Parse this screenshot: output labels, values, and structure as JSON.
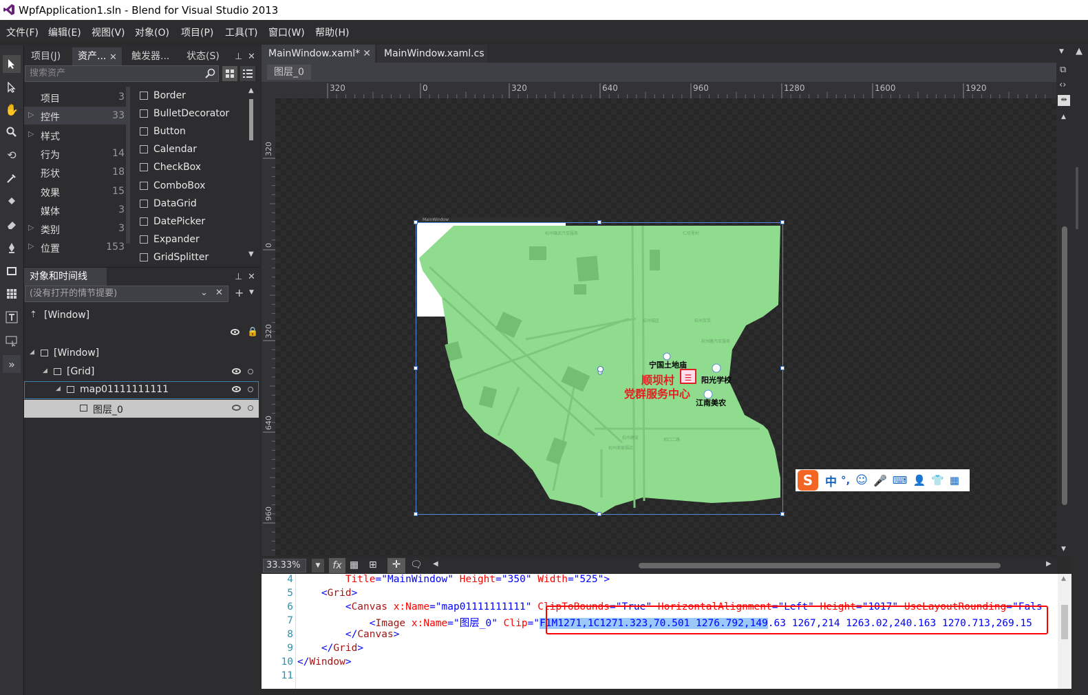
{
  "window": {
    "title": "WpfApplication1.sln - Blend for Visual Studio 2013"
  },
  "menu": [
    "文件(F)",
    "编辑(E)",
    "视图(V)",
    "对象(O)",
    "项目(P)",
    "工具(T)",
    "窗口(W)",
    "帮助(H)"
  ],
  "toolbox": [
    "selection-tool",
    "direct-selection-tool",
    "pan-tool",
    "zoom-tool",
    "camera-orbit-tool",
    "eyedropper-tool",
    "paint-bucket-tool",
    "brush-transform-tool",
    "pen-tool",
    "rectangle-tool",
    "grid-tool",
    "textblock-tool",
    "control-tool",
    "assets-expander"
  ],
  "assets_panel": {
    "tabs": [
      "项目(J)",
      "资产...",
      "触发器...",
      "状态(S)"
    ],
    "search_placeholder": "搜索资产",
    "categories": [
      {
        "label": "项目",
        "count": "3",
        "expandable": false
      },
      {
        "label": "控件",
        "count": "33",
        "expandable": true,
        "selected": true
      },
      {
        "label": "样式",
        "count": "",
        "expandable": true
      },
      {
        "label": "行为",
        "count": "14",
        "expandable": false
      },
      {
        "label": "形状",
        "count": "18",
        "expandable": false
      },
      {
        "label": "效果",
        "count": "15",
        "expandable": false
      },
      {
        "label": "媒体",
        "count": "3",
        "expandable": false
      },
      {
        "label": "类别",
        "count": "3",
        "expandable": true
      },
      {
        "label": "位置",
        "count": "153",
        "expandable": true
      }
    ],
    "controls": [
      "Border",
      "BulletDecorator",
      "Button",
      "Calendar",
      "CheckBox",
      "ComboBox",
      "DataGrid",
      "DatePicker",
      "Expander",
      "GridSplitter"
    ]
  },
  "objects_panel": {
    "title": "对象和时间线(B)",
    "storyboard_placeholder": "(没有打开的情节提要)",
    "root_label": "[Window]",
    "tree": [
      {
        "label": "[Window]",
        "level": 0,
        "expanded": true
      },
      {
        "label": "[Grid]",
        "level": 1,
        "expanded": true
      },
      {
        "label": "map01111111111",
        "level": 2,
        "expanded": true,
        "selected": true
      },
      {
        "label": "图层_0",
        "level": 3,
        "highlighted": true
      }
    ]
  },
  "documents": {
    "tabs": [
      {
        "label": "MainWindow.xaml*",
        "active": true,
        "closable": true
      },
      {
        "label": "MainWindow.xaml.cs",
        "active": false,
        "closable": false
      }
    ],
    "breadcrumb": "图层_0",
    "ruler_h_ticks": [
      "320",
      "0",
      "320",
      "640",
      "960",
      "1280",
      "1600",
      "1920"
    ],
    "ruler_h_markers": [
      "518.6",
      "765.4"
    ],
    "ruler_v_ticks": [
      "320",
      "0",
      "320",
      "640",
      "960"
    ],
    "ruler_v_markers": [
      "320.4",
      "696.6"
    ]
  },
  "map": {
    "colors": {
      "land": "#8fdc8f",
      "road": "#7ccb7c",
      "block": "#6fb96f"
    },
    "poi": [
      {
        "label": "宁国土地庙",
        "kind": "place"
      },
      {
        "label": "阳光学校",
        "kind": "school"
      },
      {
        "label": "江南美农",
        "kind": "shop"
      },
      {
        "label": "顺坝村",
        "kind": "red-title"
      },
      {
        "label": "党群服务中心",
        "kind": "red-title"
      }
    ],
    "mini_window_title": "MainWindow"
  },
  "ime_toolbar": {
    "logo": "S",
    "mode": "中",
    "punct": "°,"
  },
  "bottom_bar": {
    "zoom": "33.33%"
  },
  "xaml_editor": {
    "lines": [
      {
        "num": "4",
        "parts": [
          {
            "t": "        ",
            "c": ""
          },
          {
            "t": "Title",
            "c": "ab"
          },
          {
            "t": "=\"",
            "c": "vb"
          },
          {
            "t": "MainWindow",
            "c": "vb"
          },
          {
            "t": "\" ",
            "c": "vb"
          },
          {
            "t": "Height",
            "c": "ab"
          },
          {
            "t": "=\"",
            "c": "vb"
          },
          {
            "t": "350",
            "c": "vb"
          },
          {
            "t": "\" ",
            "c": "vb"
          },
          {
            "t": "Width",
            "c": "ab"
          },
          {
            "t": "=\"",
            "c": "vb"
          },
          {
            "t": "525",
            "c": "vb"
          },
          {
            "t": "\">",
            "c": "vb"
          }
        ]
      },
      {
        "num": "5",
        "parts": [
          {
            "t": "    <",
            "c": "vb"
          },
          {
            "t": "Grid",
            "c": "tb"
          },
          {
            "t": ">",
            "c": "vb"
          }
        ]
      },
      {
        "num": "6",
        "parts": [
          {
            "t": "        <",
            "c": "vb"
          },
          {
            "t": "Canvas",
            "c": "tb"
          },
          {
            "t": " x:Name",
            "c": "ab"
          },
          {
            "t": "=\"",
            "c": "vb"
          },
          {
            "t": "map01111111111",
            "c": "vb"
          },
          {
            "t": "\" ",
            "c": "vb"
          },
          {
            "t": "ClipToBounds",
            "c": "ab"
          },
          {
            "t": "=\"",
            "c": "vb"
          },
          {
            "t": "True",
            "c": "vb"
          },
          {
            "t": "\" ",
            "c": "vb"
          },
          {
            "t": "HorizontalAlignment",
            "c": "ab"
          },
          {
            "t": "=\"",
            "c": "vb"
          },
          {
            "t": "Left",
            "c": "vb"
          },
          {
            "t": "\" ",
            "c": "vb"
          },
          {
            "t": "Height",
            "c": "ab"
          },
          {
            "t": "=\"",
            "c": "vb"
          },
          {
            "t": "1017",
            "c": "vb"
          },
          {
            "t": "\" ",
            "c": "vb"
          },
          {
            "t": "UseLayoutRounding",
            "c": "ab"
          },
          {
            "t": "=\"",
            "c": "vb"
          },
          {
            "t": "Fals",
            "c": "vb"
          }
        ]
      },
      {
        "num": "7",
        "parts": [
          {
            "t": "            <",
            "c": "vb"
          },
          {
            "t": "Image",
            "c": "tb"
          },
          {
            "t": " x:Name",
            "c": "ab"
          },
          {
            "t": "=\"",
            "c": "vb"
          },
          {
            "t": "图层_0",
            "c": "vb"
          },
          {
            "t": "\" ",
            "c": "vb"
          },
          {
            "t": "Clip",
            "c": "ab"
          },
          {
            "t": "=\"",
            "c": "vb"
          },
          {
            "t": "F1M1271,1C1271.323,70.501 1276.792,149",
            "c": "vb sel"
          },
          {
            "t": ".63 1267,214 1263.02,240.163 1270.713,269.15",
            "c": "vb"
          }
        ]
      },
      {
        "num": "8",
        "parts": [
          {
            "t": "        </",
            "c": "vb"
          },
          {
            "t": "Canvas",
            "c": "tb"
          },
          {
            "t": ">",
            "c": "vb"
          }
        ]
      },
      {
        "num": "9",
        "parts": [
          {
            "t": "    </",
            "c": "vb"
          },
          {
            "t": "Grid",
            "c": "tb"
          },
          {
            "t": ">",
            "c": "vb"
          }
        ]
      },
      {
        "num": "10",
        "parts": [
          {
            "t": "</",
            "c": "vb"
          },
          {
            "t": "Window",
            "c": "tb"
          },
          {
            "t": ">",
            "c": "vb"
          }
        ]
      },
      {
        "num": "11",
        "parts": []
      }
    ]
  },
  "colors": {
    "selection": "#99c9ff",
    "highlight_box": "#ff0000",
    "accent": "#3c7fb1"
  }
}
